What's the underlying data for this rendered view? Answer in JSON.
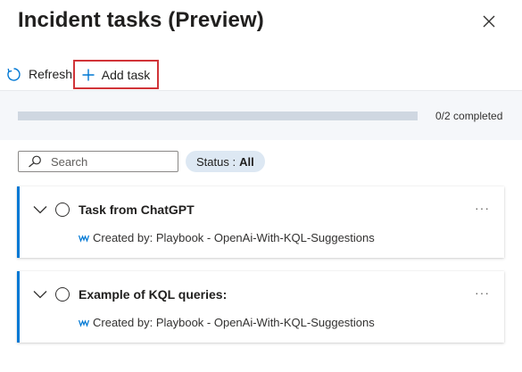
{
  "panel": {
    "title": "Incident tasks (Preview)",
    "close_icon": "close-icon"
  },
  "toolbar": {
    "refresh_label": "Refresh",
    "refresh_icon": "refresh-icon",
    "add_label": "Add task",
    "add_icon": "plus-icon",
    "highlight_color": "#d13438"
  },
  "progress": {
    "completed": 0,
    "total": 2,
    "label": "0/2 completed"
  },
  "search": {
    "placeholder": "Search",
    "icon": "search-icon"
  },
  "filter": {
    "label": "Status :",
    "value": "All"
  },
  "tasks": [
    {
      "title": "Task from ChatGPT",
      "created_by": "Created by: Playbook - OpenAi-With-KQL-Suggestions",
      "more": "···"
    },
    {
      "title": "Example of KQL queries:",
      "created_by": "Created by: Playbook - OpenAi-With-KQL-Suggestions",
      "more": "···"
    }
  ],
  "colors": {
    "accent": "#0078d4",
    "progress_track": "#cfd7e1",
    "pill_bg": "#dde8f3"
  }
}
